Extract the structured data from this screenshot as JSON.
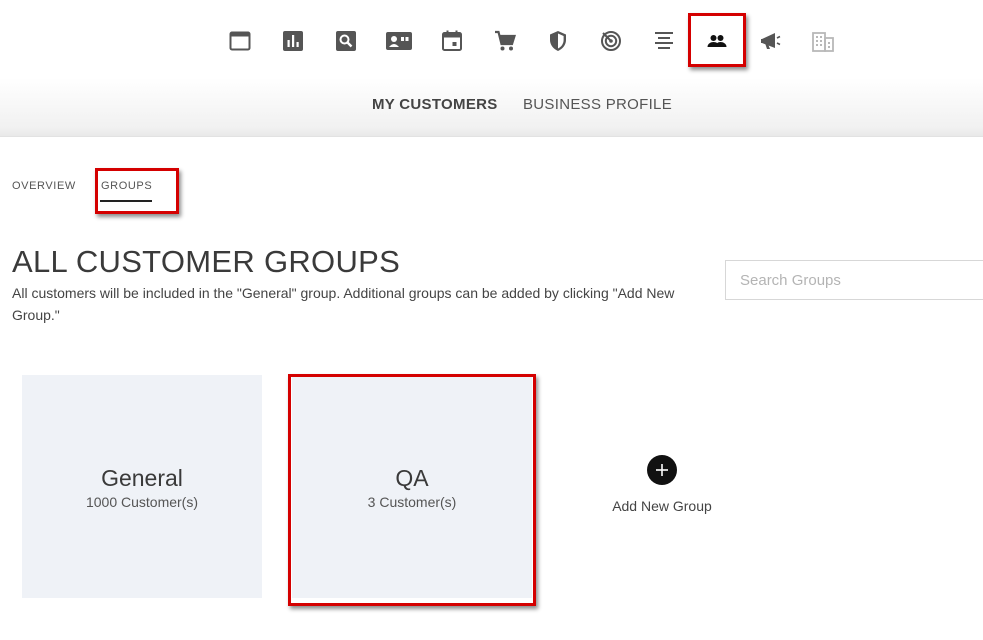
{
  "nav": {
    "icons": [
      "window-icon",
      "bar-chart-icon",
      "search-icon",
      "contact-card-icon",
      "calendar-icon",
      "cart-icon",
      "shield-icon",
      "target-icon",
      "align-center-icon",
      "people-icon",
      "megaphone-icon",
      "building-icon"
    ],
    "active_icon": "people-icon",
    "links": [
      "MY CUSTOMERS",
      "BUSINESS PROFILE"
    ]
  },
  "subtabs": [
    "OVERVIEW",
    "GROUPS"
  ],
  "active_subtab": "GROUPS",
  "page": {
    "title": "ALL CUSTOMER GROUPS",
    "description": "All customers will be included in the \"General\" group. Additional groups can be added by clicking \"Add New Group.\""
  },
  "search": {
    "placeholder": "Search Groups",
    "value": ""
  },
  "groups": [
    {
      "name": "General",
      "count": "1000 Customer(s)"
    },
    {
      "name": "QA",
      "count": "3 Customer(s)"
    }
  ],
  "add_group": {
    "label": "Add New Group",
    "icon": "plus-icon"
  },
  "colors": {
    "highlight": "#d40000",
    "card_bg": "#eff2f7",
    "icon": "#555555",
    "icon_disabled": "#b8b8b8"
  }
}
